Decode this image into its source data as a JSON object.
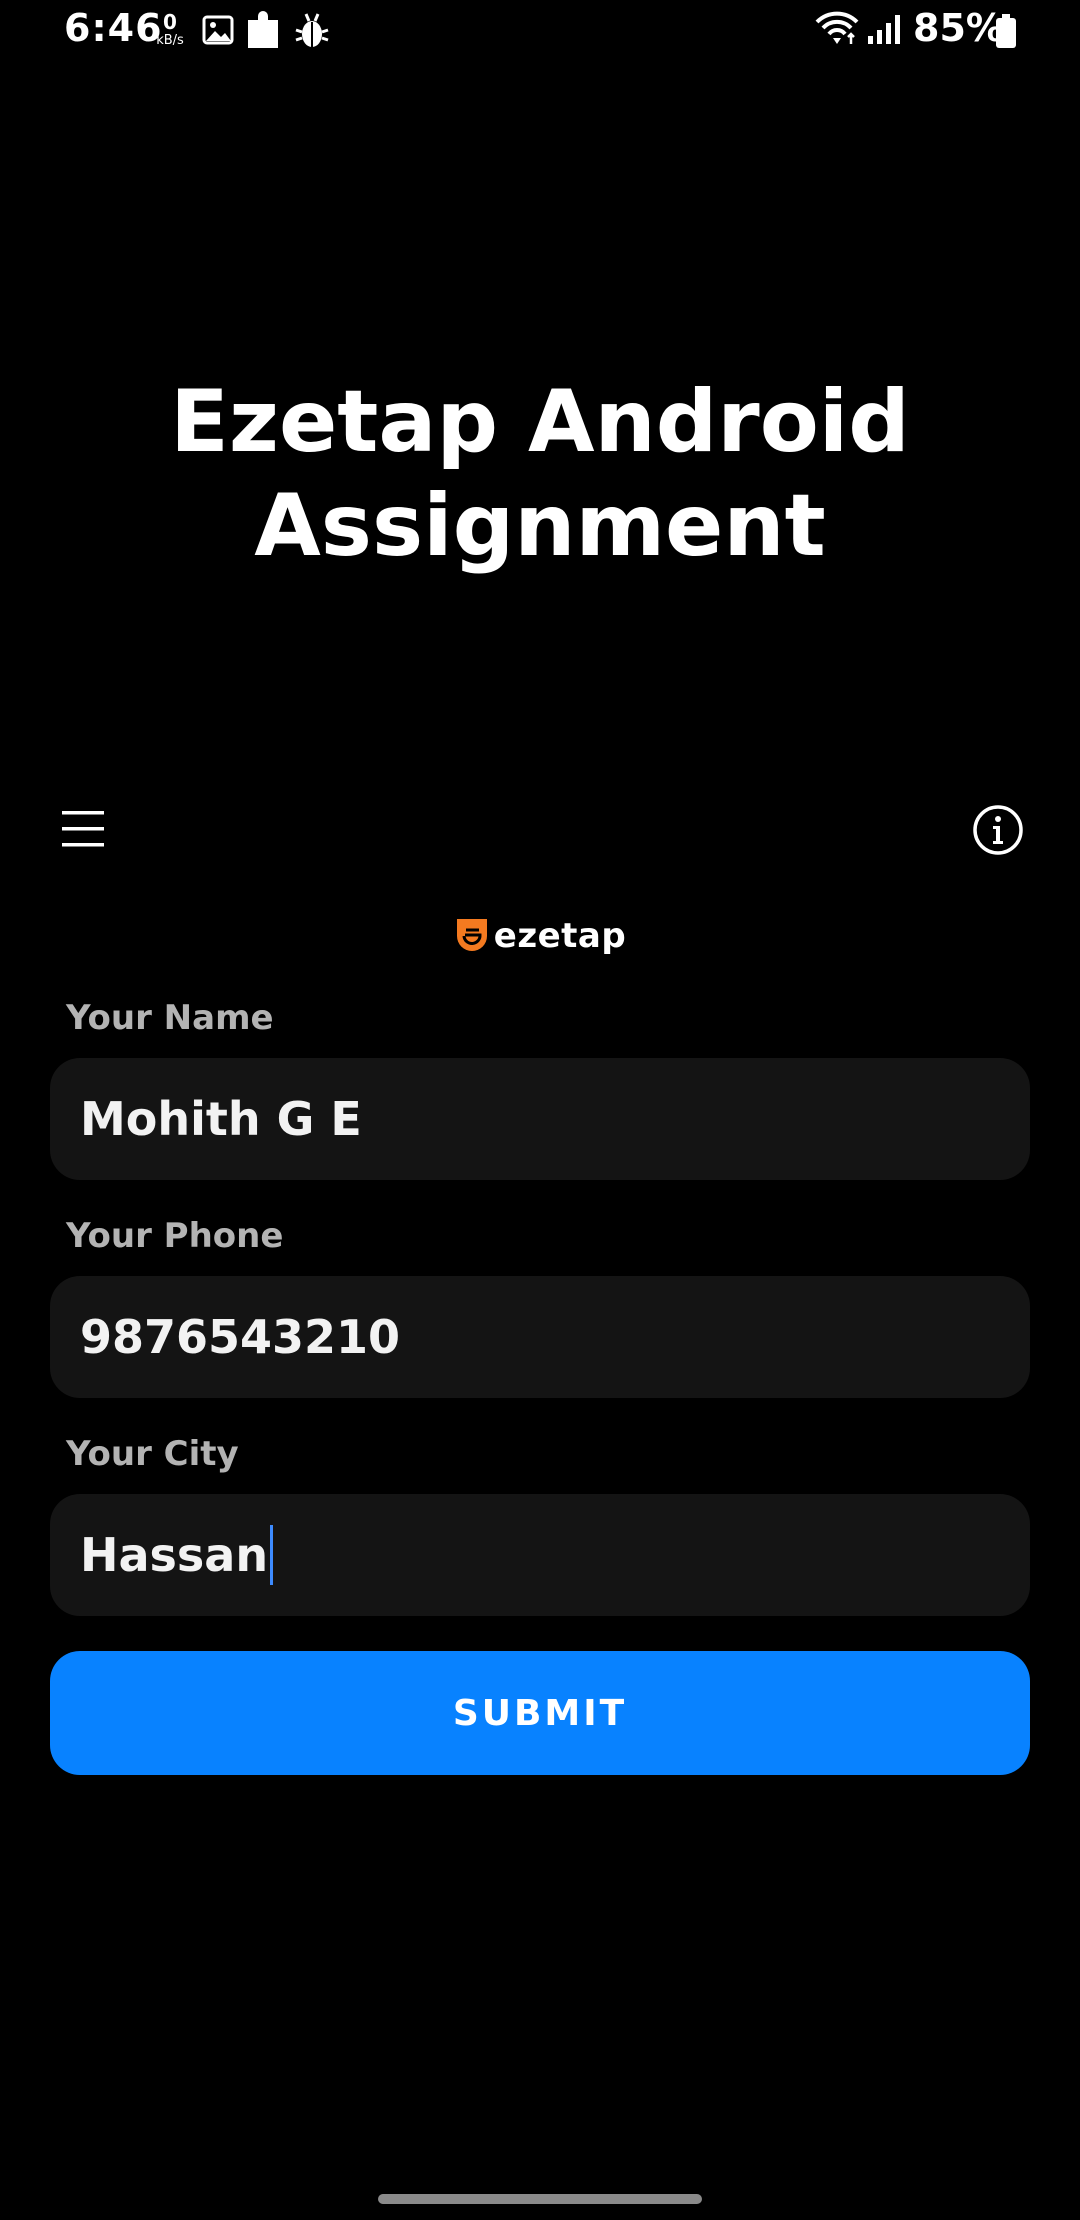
{
  "status_bar": {
    "time": "6:46",
    "net_speed_value": "0",
    "net_speed_unit": "kB/s",
    "notification_icons": [
      "image-icon",
      "puzzle-icon",
      "bug-icon"
    ],
    "connectivity_icons": [
      "wifi-icon",
      "signal-icon"
    ],
    "battery_percent": "85%",
    "battery_icon": "battery-icon"
  },
  "header": {
    "title_line1": "Ezetap Android",
    "title_line2": "Assignment"
  },
  "toolbar": {
    "menu_icon": "hamburger-menu-icon",
    "info_icon": "info-icon"
  },
  "logo": {
    "text": "ezetap",
    "accent": "#f47a20"
  },
  "form": {
    "name_label": "Your Name",
    "name_value": "Mohith G E",
    "phone_label": "Your Phone",
    "phone_value": "9876543210",
    "city_label": "Your City",
    "city_value": "Hassan",
    "focused_field": "city"
  },
  "submit": {
    "label": "SUBMIT",
    "color": "#0882ff"
  },
  "colors": {
    "background": "#000000",
    "field_background": "#141414",
    "label_text": "#b3b3b3",
    "caret": "#3d8bff"
  }
}
